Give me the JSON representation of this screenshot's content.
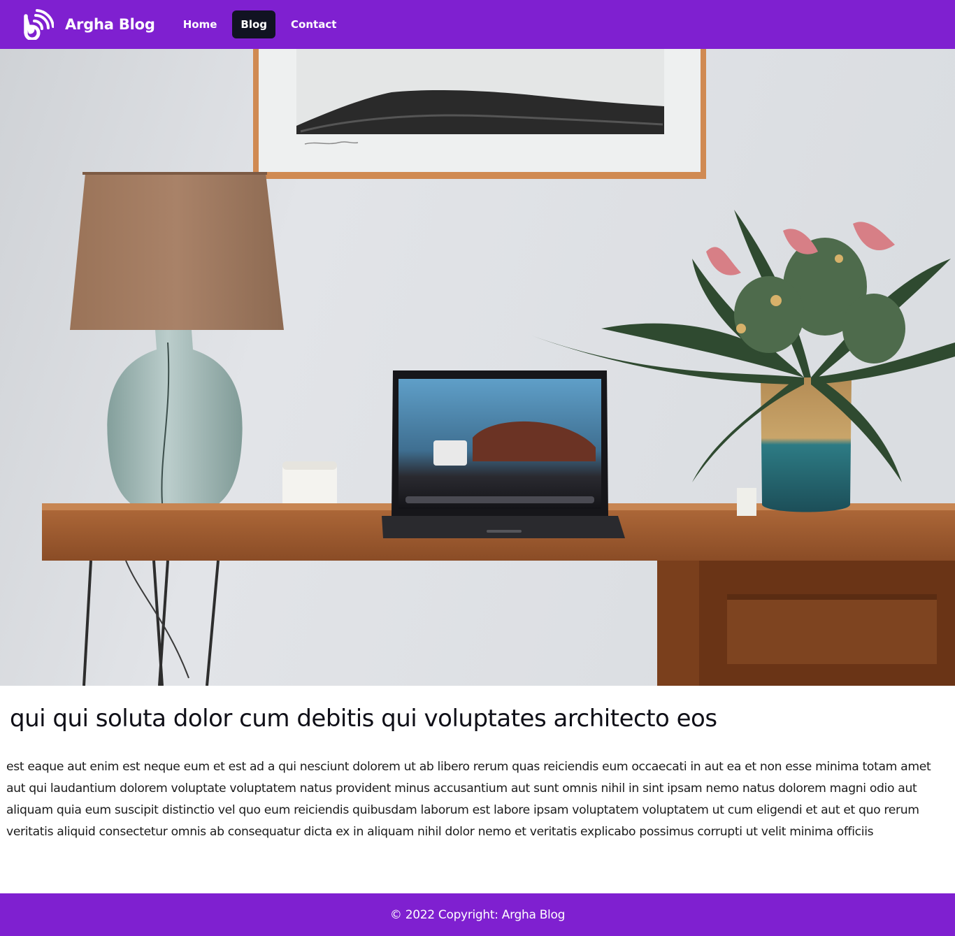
{
  "navbar": {
    "brand": "Argha Blog",
    "logo_icon": "blog-rss-icon",
    "links": [
      {
        "label": "Home",
        "active": false
      },
      {
        "label": "Blog",
        "active": true
      },
      {
        "label": "Contact",
        "active": false
      }
    ],
    "background": "#7f20d0",
    "active_background": "#111322"
  },
  "hero": {
    "subject": "desk-with-lamp-laptop-and-flower-vase"
  },
  "post": {
    "title": "qui qui soluta dolor cum debitis qui voluptates architecto eos",
    "body": "est eaque aut enim est neque eum et est ad a qui nesciunt dolorem ut ab libero rerum quas reiciendis eum occaecati in aut ea et non esse minima totam amet aut qui laudantium dolorem voluptate voluptatem natus provident minus accusantium aut sunt omnis nihil in sint ipsam nemo natus dolorem magni odio aut aliquam quia eum suscipit distinctio vel quo eum reiciendis quibusdam laborum est labore ipsam voluptatem voluptatem ut cum eligendi et aut et quo rerum veritatis aliquid consectetur omnis ab consequatur dicta ex in aliquam nihil dolor nemo et veritatis explicabo possimus corrupti ut velit minima officiis"
  },
  "footer": {
    "text": "© 2022 Copyright: Argha Blog"
  }
}
